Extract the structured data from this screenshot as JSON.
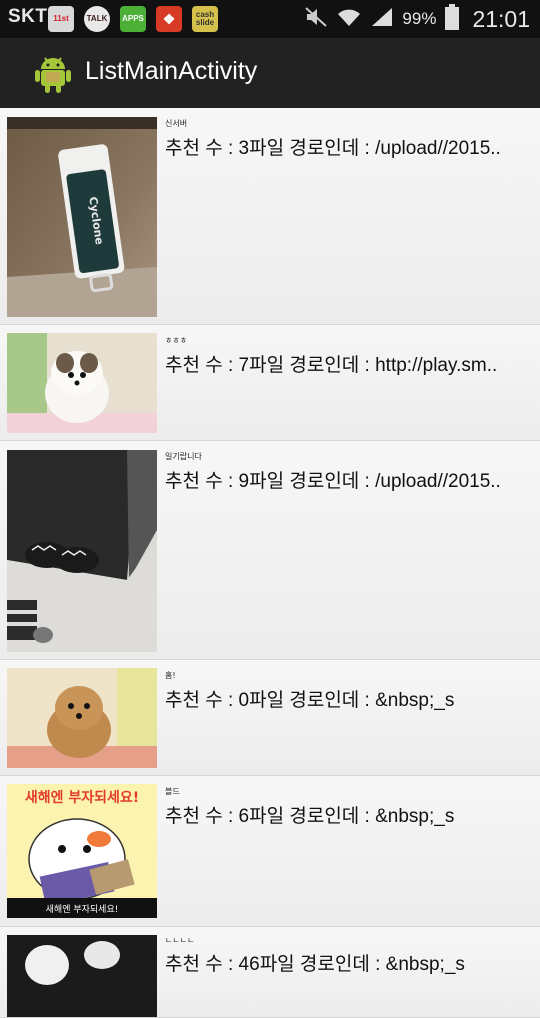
{
  "status_bar": {
    "carrier": "SKT",
    "apps": [
      {
        "icon": "11st-app-icon",
        "label": "11st",
        "bg": "#d8d8d8",
        "fg": "#d2232a"
      },
      {
        "icon": "kakaotalk-app-icon",
        "label": "TALK",
        "bg": "#e9e9e9",
        "fg": "#3c1e1e"
      },
      {
        "icon": "apps-store-icon",
        "label": "APPS",
        "bg": "#4caf36",
        "fg": "#ffffff"
      },
      {
        "icon": "red-app-icon",
        "label": "",
        "bg": "#d83b25",
        "fg": "#ffffff"
      },
      {
        "icon": "cashslide-app-icon",
        "label": "cash slide",
        "bg": "#d4c04a",
        "fg": "#333333"
      }
    ],
    "battery_percent": "99%",
    "time": "21:01"
  },
  "action_bar": {
    "title": "ListMainActivity",
    "icon": "android-icon",
    "accent": "#a4c639"
  },
  "list": {
    "items": [
      {
        "author": "신서버",
        "text": "추천 수 : 3파일 경로인데 : /upload//2015..",
        "image": "usb-drive-photo"
      },
      {
        "author": "ㅎㅎㅎ",
        "text": "추천 수 : 7파일 경로인데 : http://play.sm..",
        "image": "pomeranian-puppy-white-photo"
      },
      {
        "author": "일기랍니다",
        "text": "추천 수 : 9파일 경로인데 : /upload//2015..",
        "image": "shoes-on-floor-photo"
      },
      {
        "author": "홈!",
        "text": "추천 수 : 0파일 경로인데 : &nbsp;_s",
        "image": "pomeranian-puppy-brown-photo"
      },
      {
        "author": "블드",
        "text": "추천 수 : 6파일 경로인데 : &nbsp;_s",
        "image": "new-year-cartoon-image",
        "image_caption": "새해엔 부자되세요!",
        "image_footer": "새해엔 부자되세요!"
      },
      {
        "author": "ㄴㄴㄴㄴ",
        "text": "추천 수 : 46파일 경로인데 : &nbsp;_s",
        "image": "white-dog-photo"
      }
    ]
  }
}
